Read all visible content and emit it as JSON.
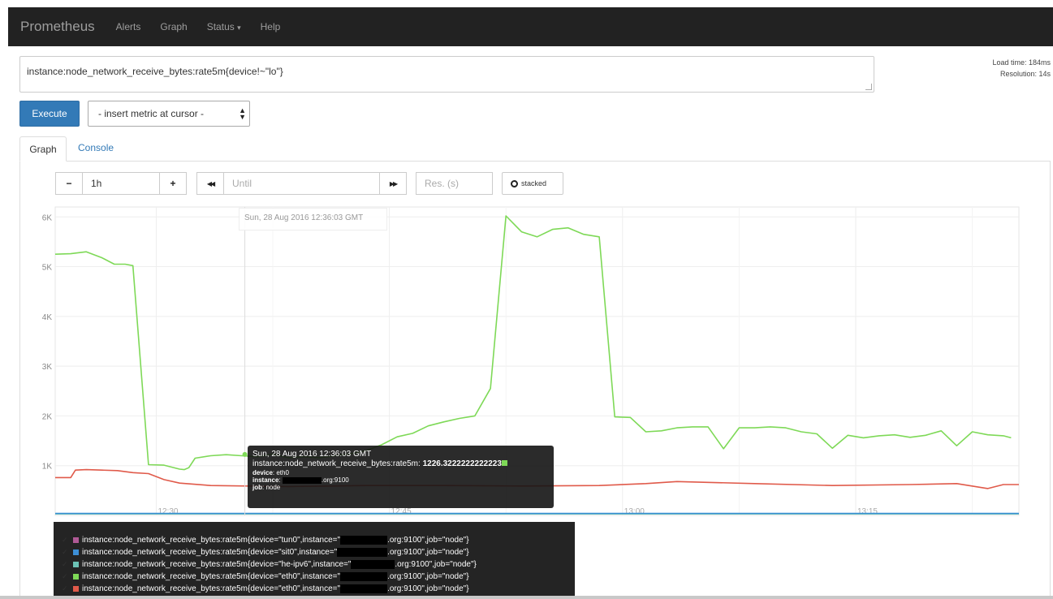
{
  "navbar": {
    "brand": "Prometheus",
    "items": [
      "Alerts",
      "Graph",
      "Status",
      "Help"
    ],
    "status_caret": "▾"
  },
  "expression": {
    "value": "instance:node_network_receive_bytes:rate5m{device!~\"lo\"}"
  },
  "load_info": {
    "load_time": "Load time: 184ms",
    "resolution": "Resolution: 14s"
  },
  "execute_label": "Execute",
  "insert_metric_label": "- insert metric at cursor -",
  "tabs": {
    "graph": "Graph",
    "console": "Console"
  },
  "controls": {
    "minus": "−",
    "range": "1h",
    "plus": "+",
    "back": "◀◀",
    "until_placeholder": "Until",
    "forward": "▶▶",
    "res_placeholder": "Res. (s)",
    "stacked": "stacked"
  },
  "hover_label": "Sun, 28 Aug 2016 12:36:03 GMT",
  "tooltip": {
    "time": "Sun, 28 Aug 2016 12:36:03 GMT",
    "metric": "instance:node_network_receive_bytes:rate5m:",
    "value": "1226.3222222222223",
    "device_key": "device",
    "device_val": ": eth0",
    "instance_key": "instance",
    "instance_val": ".org:9100",
    "job_key": "job",
    "job_val": ": node"
  },
  "legend": {
    "items": [
      {
        "prefix": "instance:node_network_receive_bytes:rate5m{device=\"tun0\",instance=\"",
        "suffix": ".org:9100\",job=\"node\"}",
        "color": "#b05a96"
      },
      {
        "prefix": "instance:node_network_receive_bytes:rate5m{device=\"sit0\",instance=\"",
        "suffix": ".org:9100\",job=\"node\"}",
        "color": "#3d8fd6"
      },
      {
        "prefix": "instance:node_network_receive_bytes:rate5m{device=\"he-ipv6\",instance=\"",
        "suffix": ".org:9100\",job=\"node\"}",
        "color": "#6cc3b6"
      },
      {
        "prefix": "instance:node_network_receive_bytes:rate5m{device=\"eth0\",instance=\"",
        "suffix": ".org:9100\",job=\"node\"}",
        "color": "#7ed957"
      },
      {
        "prefix": "instance:node_network_receive_bytes:rate5m{device=\"eth0\",instance=\"",
        "suffix": ".org:9100\",job=\"node\"}",
        "color": "#e05a4a"
      }
    ]
  },
  "chart_data": {
    "type": "line",
    "title": "",
    "xlabel": "",
    "ylabel": "",
    "x_ticks": [
      "12:30",
      "12:45",
      "13:00",
      "13:15"
    ],
    "y_ticks": [
      "1K",
      "2K",
      "3K",
      "4K",
      "5K",
      "6K"
    ],
    "ylim": [
      0,
      6200
    ],
    "xlim_minutes": [
      0,
      62
    ],
    "grid": true,
    "series": [
      {
        "color": "#7ed957",
        "x": [
          0,
          1,
          2,
          3,
          3.8,
          4.5,
          5,
          6,
          7,
          8,
          8.3,
          8.6,
          9,
          10,
          11,
          12,
          13,
          14,
          15,
          16,
          17,
          18,
          19,
          20,
          21,
          22,
          23,
          24,
          25,
          26,
          27,
          28,
          29,
          30,
          31,
          32,
          33,
          34,
          35,
          36,
          37,
          38,
          39,
          40,
          41,
          42,
          43,
          44,
          45,
          46,
          47,
          48,
          49,
          50,
          51,
          52,
          53,
          54,
          55,
          56,
          57,
          58,
          59,
          60,
          61,
          61.5
        ],
        "y": [
          5250,
          5260,
          5300,
          5180,
          5050,
          5050,
          5020,
          1020,
          1010,
          930,
          920,
          960,
          1150,
          1200,
          1220,
          1200,
          1180,
          1230,
          1160,
          1180,
          1160,
          1200,
          1240,
          1300,
          1420,
          1580,
          1650,
          1800,
          1880,
          1950,
          2000,
          2550,
          6020,
          5700,
          5600,
          5750,
          5780,
          5650,
          5600,
          1980,
          1970,
          1680,
          1700,
          1760,
          1780,
          1780,
          1340,
          1760,
          1760,
          1780,
          1760,
          1680,
          1640,
          1350,
          1610,
          1560,
          1600,
          1620,
          1570,
          1610,
          1700,
          1400,
          1680,
          1620,
          1600,
          1560
        ]
      },
      {
        "color": "#e05a4a",
        "x": [
          0,
          1,
          1.3,
          2,
          3,
          4,
          5,
          6,
          7,
          8,
          10,
          15,
          20,
          25,
          30,
          35,
          38,
          40,
          45,
          50,
          55,
          58,
          60,
          61,
          62
        ],
        "y": [
          760,
          760,
          910,
          920,
          910,
          900,
          860,
          840,
          720,
          650,
          600,
          580,
          600,
          600,
          590,
          600,
          640,
          680,
          640,
          600,
          620,
          640,
          540,
          620,
          620
        ]
      },
      {
        "color": "#3d8fd6",
        "x": [
          0,
          62
        ],
        "y": [
          40,
          40
        ]
      },
      {
        "color": "#6cc3b6",
        "x": [
          0,
          62
        ],
        "y": [
          30,
          30
        ]
      }
    ]
  }
}
